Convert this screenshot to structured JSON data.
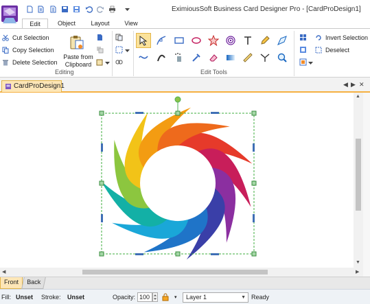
{
  "window": {
    "title": "EximiousSoft Business Card Designer Pro - [CardProDesign1]"
  },
  "tabs": [
    "Edit",
    "Object",
    "Layout",
    "View"
  ],
  "ribbon": {
    "editing": {
      "cut": "Cut Selection",
      "copy": "Copy Selection",
      "delete": "Delete Selection",
      "paste_line1": "Paste from",
      "paste_line2": "Clipboard",
      "group_label": "Editing"
    },
    "edit_tools": {
      "group_label": "Edit Tools"
    },
    "selection": {
      "invert": "Invert Selection",
      "deselect": "Deselect"
    }
  },
  "document": {
    "tab_label": "CardProDesign1"
  },
  "page_tabs": {
    "front": "Front",
    "back": "Back"
  },
  "status": {
    "fill_label": "Fill:",
    "fill_value": "Unset",
    "stroke_label": "Stroke:",
    "stroke_value": "Unset",
    "opacity_label": "Opacity:",
    "opacity_value": "100",
    "layer": "Layer 1",
    "state": "Ready"
  },
  "logo": {
    "petal_colors": [
      "#e63a2a",
      "#c81e5a",
      "#8b2fa0",
      "#3a3fa8",
      "#1f74c8",
      "#1aa7d8",
      "#13b0a6",
      "#8cc63f",
      "#f2c318",
      "#f39c12",
      "#ee6a1c"
    ]
  }
}
